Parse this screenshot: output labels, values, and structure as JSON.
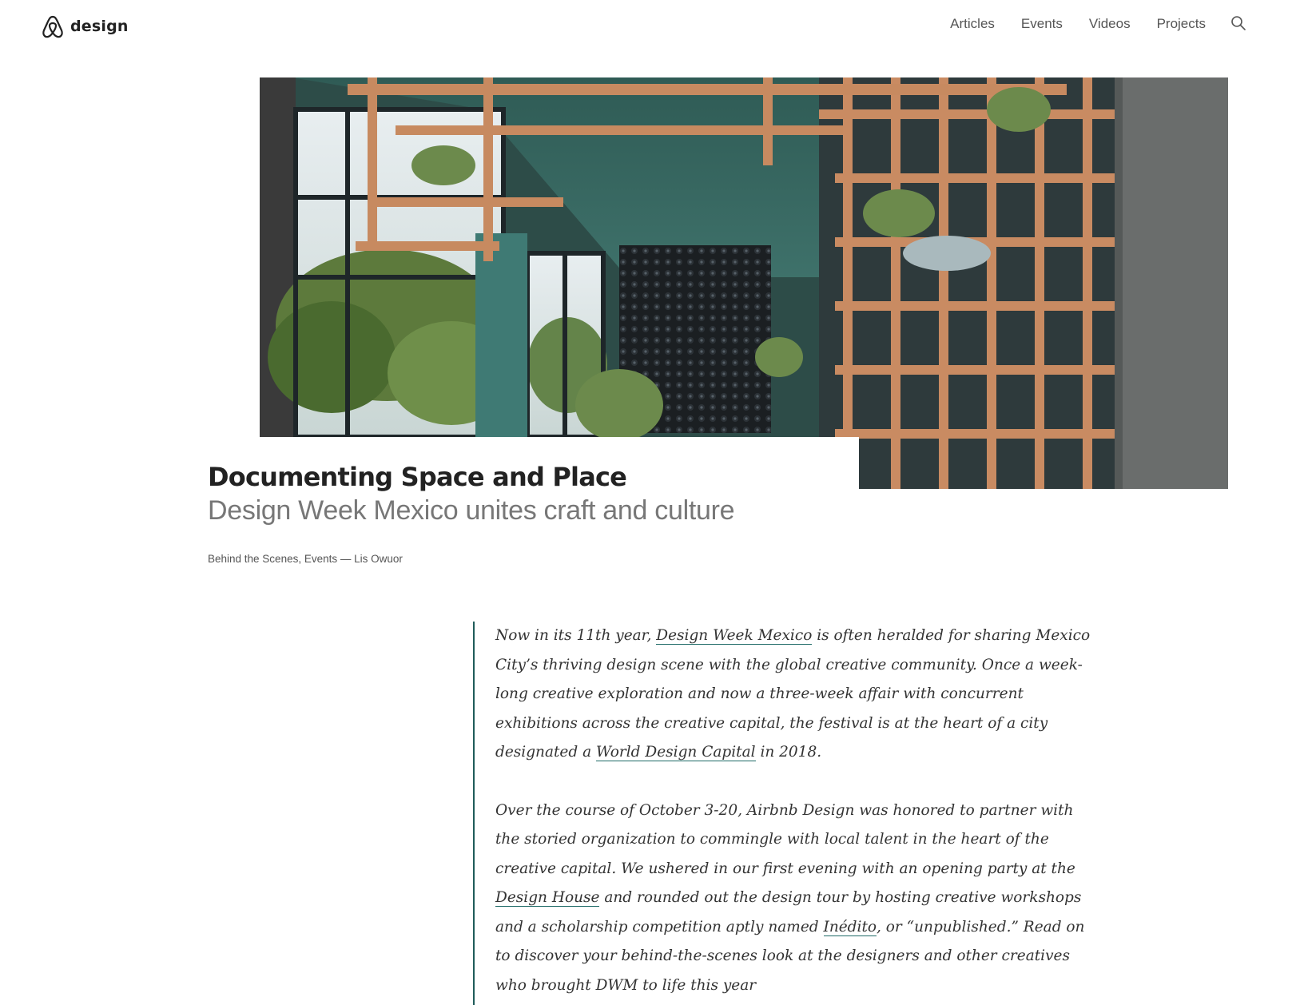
{
  "header": {
    "logo_text": "design",
    "nav": [
      "Articles",
      "Events",
      "Videos",
      "Projects"
    ]
  },
  "icons": {
    "logo": "airbnb-belo-icon",
    "search": "search-icon"
  },
  "hero": {
    "image": "interior with wooden lattice shelving and plants"
  },
  "article": {
    "title": "Documenting Space and Place",
    "subtitle": "Design Week Mexico unites craft and culture",
    "meta": {
      "categories": "Behind the Scenes, Events",
      "separator": " — ",
      "author": "Lis Owuor"
    },
    "p1": {
      "t1": " Now in its 11th year, ",
      "link1": "Design Week Mexico",
      "t2": " is often heralded for sharing Mexico City’s thriving design scene with the global creative community. Once a week-long creative exploration and now a three-week affair with concurrent exhibitions across the creative capital, the festival is at the heart of a city designated a ",
      "link2": "World Design Capital",
      "t3": " in 2018."
    },
    "p2": {
      "t1": "Over the course of October 3-20, Airbnb Design was honored to partner with the storied organization to commingle with local talent in the heart of the creative capital. We ushered in our first evening with an opening party at the ",
      "link1": "Design House",
      "t2": " and rounded out the design tour by hosting creative workshops and a scholarship competition aptly named ",
      "link2": "Inédito",
      "t3": ", or “unpublished.” Read on to discover your behind-the-scenes look at the designers and other creatives who brought DWM to life this year"
    }
  },
  "colors": {
    "accent": "#1f5c5a",
    "text": "#222222",
    "muted": "#777777"
  }
}
